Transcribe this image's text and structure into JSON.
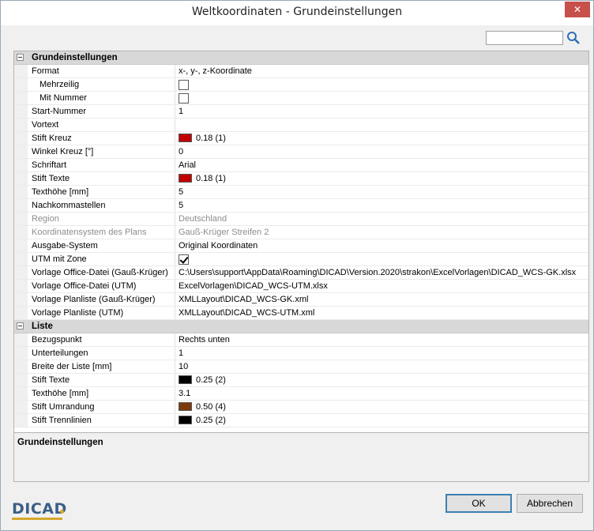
{
  "window": {
    "title": "Weltkoordinaten - Grundeinstellungen",
    "close_label": "✕"
  },
  "search": {
    "value": "",
    "placeholder": ""
  },
  "categories": [
    {
      "label": "Grundeinstellungen",
      "rows": [
        {
          "label": "Format",
          "value": "x-, y-, z-Koordinate"
        },
        {
          "label": "Mehrzeilig",
          "checkbox": false
        },
        {
          "label": "Mit Nummer",
          "checkbox": false
        },
        {
          "label": "Start-Nummer",
          "value": "1"
        },
        {
          "label": "Vortext",
          "value": ""
        },
        {
          "label": "Stift Kreuz",
          "value": "0.18 (1)",
          "color": "#c00000"
        },
        {
          "label": "Winkel Kreuz [°]",
          "value": "0"
        },
        {
          "label": "Schriftart",
          "value": "Arial"
        },
        {
          "label": "Stift Texte",
          "value": "0.18 (1)",
          "color": "#c00000"
        },
        {
          "label": "Texthöhe [mm]",
          "value": "5"
        },
        {
          "label": "Nachkommastellen",
          "value": "5"
        },
        {
          "label": "Region",
          "value": "Deutschland",
          "disabled": true
        },
        {
          "label": "Koordinatensystem des Plans",
          "value": "Gauß-Krüger Streifen 2",
          "disabled": true
        },
        {
          "label": "Ausgabe-System",
          "value": "Original Koordinaten"
        },
        {
          "label": "UTM mit Zone",
          "checkbox": true
        },
        {
          "label": "Vorlage Office-Datei (Gauß-Krüger)",
          "value": "C:\\Users\\support\\AppData\\Roaming\\DICAD\\Version.2020\\strakon\\ExcelVorlagen\\DICAD_WCS-GK.xlsx"
        },
        {
          "label": "Vorlage Office-Datei (UTM)",
          "value": "ExcelVorlagen\\DICAD_WCS-UTM.xlsx"
        },
        {
          "label": "Vorlage Planliste (Gauß-Krüger)",
          "value": "XMLLayout\\DICAD_WCS-GK.xml"
        },
        {
          "label": "Vorlage Planliste (UTM)",
          "value": "XMLLayout\\DICAD_WCS-UTM.xml"
        }
      ]
    },
    {
      "label": "Liste",
      "rows": [
        {
          "label": "Bezugspunkt",
          "value": "Rechts unten"
        },
        {
          "label": "Unterteilungen",
          "value": "1"
        },
        {
          "label": "Breite der Liste [mm]",
          "value": "10"
        },
        {
          "label": "Stift Texte",
          "value": "0.25 (2)",
          "color": "#000000"
        },
        {
          "label": "Texthöhe [mm]",
          "value": "3.1"
        },
        {
          "label": "Stift Umrandung",
          "value": "0.50 (4)",
          "color": "#7b3a0c"
        },
        {
          "label": "Stift Trennlinien",
          "value": "0.25 (2)",
          "color": "#000000"
        }
      ]
    }
  ],
  "description": {
    "title": "Grundeinstellungen"
  },
  "logo": {
    "text": "DICAD"
  },
  "buttons": {
    "ok": "OK",
    "cancel": "Abbrechen"
  }
}
